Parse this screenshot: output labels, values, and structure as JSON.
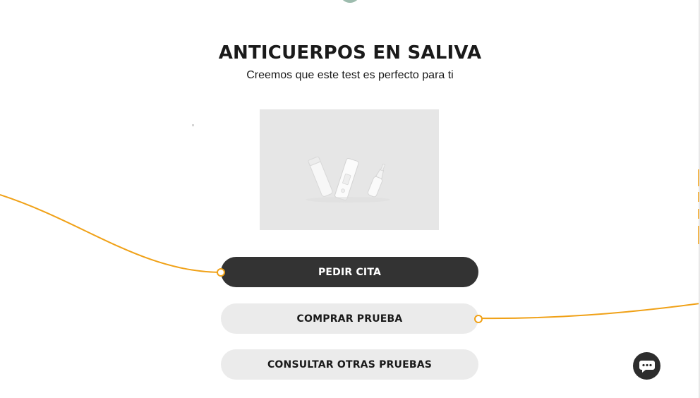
{
  "header": {
    "title": "ANTICUERPOS EN SALIVA",
    "subtitle": "Creemos que este test es perfecto para ti"
  },
  "product": {
    "image_icon": "test-kit-image"
  },
  "actions": {
    "book_label": "PEDIR CITA",
    "buy_label": "COMPRAR PRUEBA",
    "other_label": "CONSULTAR OTRAS PRUEBAS"
  },
  "chat": {
    "icon": "chat-bubble-icon"
  },
  "colors": {
    "accent_line": "#f0a117",
    "dark_button": "#333333",
    "light_button": "#ebebeb",
    "top_circle": "#9dbcae"
  }
}
